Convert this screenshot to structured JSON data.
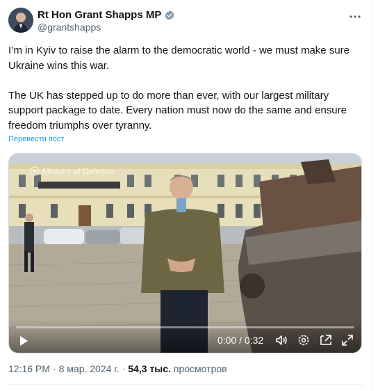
{
  "author": {
    "display_name": "Rt Hon Grant Shapps MP",
    "handle": "@grantshapps",
    "verified_icon": "verified-badge-icon",
    "verified_color": "#829aab"
  },
  "tweet": {
    "paragraph_1": "I’m in Kyiv to raise the alarm to the democratic world - we must make sure Ukraine wins this war.",
    "paragraph_2": "The UK has stepped up to do more than ever, with our largest military support package to date. Every nation must now do the same and ensure freedom triumphs over tyranny.",
    "translate_link": "Перевести пост"
  },
  "video": {
    "watermark": "Ministry of Defence",
    "time": "0:00 / 0:32",
    "progress": 0.0,
    "icons": [
      "play-icon",
      "volume-icon",
      "settings-icon",
      "pip-icon",
      "fullscreen-icon"
    ]
  },
  "meta": {
    "time": "12:16 PM",
    "sep1": "·",
    "date": "8 мар. 2024 г.",
    "sep2": "·",
    "views_count": "54,3 тыс.",
    "views_label": "просмотров"
  },
  "colors": {
    "text": "#0f1419",
    "secondary": "#536471",
    "link": "#1d9bf0"
  }
}
